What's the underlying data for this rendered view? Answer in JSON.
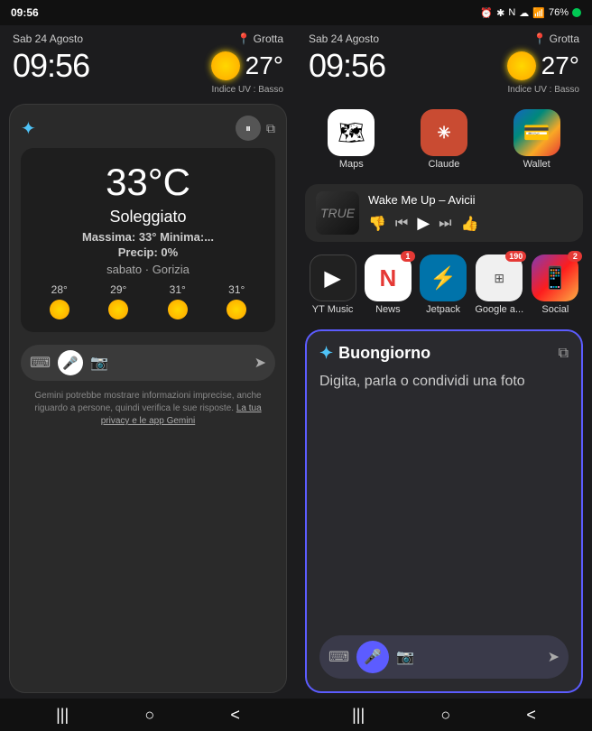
{
  "statusBar": {
    "time": "09:56",
    "icons": "⏰ ✱ N ☁ 📶 76%"
  },
  "leftPanel": {
    "date": "Sab 24 Agosto",
    "time": "09:56",
    "locationIcon": "📍",
    "location": "Grotta",
    "temperature": "27°",
    "uvIndex": "Indice UV : Basso",
    "gemini": {
      "starIcon": "✦",
      "weatherCard": {
        "temp": "33°C",
        "condition": "Soleggiato",
        "maxMin": "Massima: 33° Minima:...",
        "precip": "Precip: 0%",
        "cityDay": "sabato · Gorizia"
      },
      "hourly": [
        {
          "temp": "28°"
        },
        {
          "temp": "29°"
        },
        {
          "temp": "31°"
        },
        {
          "temp": "31°"
        }
      ],
      "disclaimer": "Gemini potrebbe mostrare informazioni imprecise, anche riguardo a persone, quindi verifica le sue risposte.",
      "privacyLink": "La tua privacy e le app Gemini"
    }
  },
  "rightPanel": {
    "date": "Sab 24 Agosto",
    "time": "09:56",
    "locationIcon": "📍",
    "location": "Grotta",
    "temperature": "27°",
    "uvIndex": "Indice UV : Basso",
    "appsRow1": [
      {
        "name": "Maps",
        "label": "Maps",
        "icon": "🗺",
        "bgClass": "icon-maps"
      },
      {
        "name": "Claude",
        "label": "Claude",
        "icon": "✳",
        "bgClass": "icon-claude"
      },
      {
        "name": "Wallet",
        "label": "Wallet",
        "icon": "💳",
        "bgClass": "icon-wallet"
      }
    ],
    "musicWidget": {
      "title": "Wake Me Up – Avicii"
    },
    "appsRow2": [
      {
        "name": "YT Music",
        "label": "YT Music",
        "icon": "▶",
        "bgClass": "icon-ytmusic",
        "badge": ""
      },
      {
        "name": "News",
        "label": "News",
        "icon": "N",
        "bgClass": "icon-news",
        "badge": "1"
      },
      {
        "name": "Jetpack",
        "label": "Jetpack",
        "icon": "⚡",
        "bgClass": "icon-jetpack",
        "badge": ""
      },
      {
        "name": "Google Apps",
        "label": "Google a...",
        "icon": "⊞",
        "bgClass": "icon-googleapps",
        "badge": "190"
      },
      {
        "name": "Social",
        "label": "Social",
        "icon": "📱",
        "bgClass": "icon-social",
        "badge": "2"
      }
    ],
    "gemini": {
      "starIcon": "✦",
      "greeting": "Buongiorno",
      "subtitle": "Digita, parla o condividi una foto",
      "externalLinkIcon": "⧉"
    }
  },
  "nav": {
    "lines": "|||",
    "circle": "○",
    "back": "<"
  }
}
